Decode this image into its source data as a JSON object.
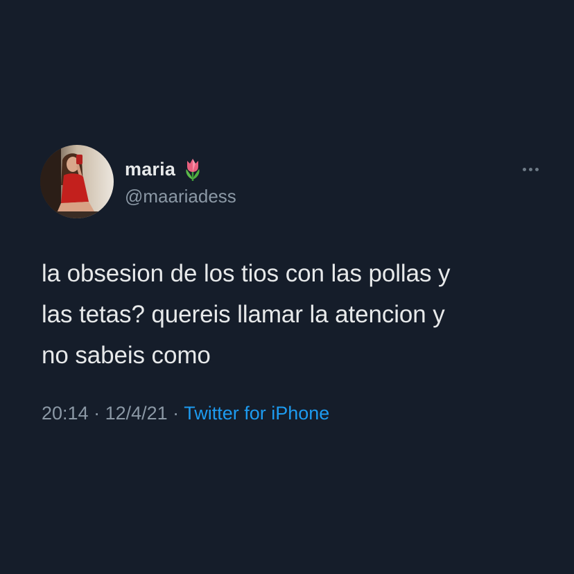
{
  "user": {
    "display_name": "maria",
    "name_emoji": "tulip-icon",
    "handle": "@maariadess",
    "avatar": "profile-photo"
  },
  "tweet": {
    "text_lines": [
      "la obsesion de los tios con las pollas y",
      "las tetas? quereis llamar la atencion y",
      "no sabeis como"
    ],
    "time": "20:14",
    "separator": " · ",
    "date": "12/4/21",
    "source": "Twitter for iPhone"
  },
  "icons": {
    "more": "more-horizontal-icon"
  },
  "colors": {
    "background": "#151d2a",
    "primary_text": "#e7e9ea",
    "secondary_text": "#8b98a5",
    "link": "#1d9bf0"
  }
}
